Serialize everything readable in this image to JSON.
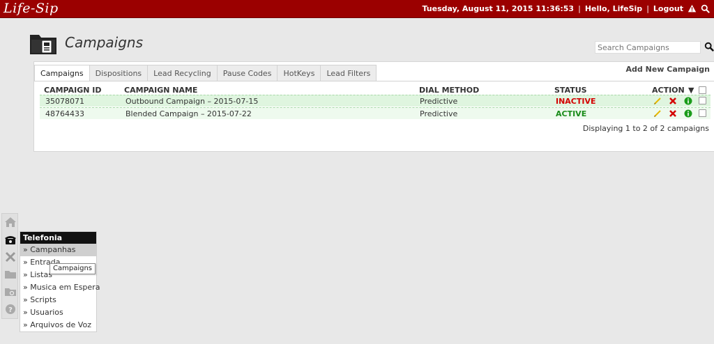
{
  "app": {
    "logo": "Life-Sip"
  },
  "topbar": {
    "datetime": "Tuesday, August 11, 2015 11:36:53",
    "sep1": "|",
    "greeting": "Hello, LifeSip",
    "sep2": "|",
    "logout": "Logout"
  },
  "page": {
    "title": "Campaigns"
  },
  "search": {
    "placeholder": "Search Campaigns"
  },
  "tabs": [
    {
      "label": "Campaigns"
    },
    {
      "label": "Dispositions"
    },
    {
      "label": "Lead Recycling"
    },
    {
      "label": "Pause Codes"
    },
    {
      "label": "HotKeys"
    },
    {
      "label": "Lead Filters"
    }
  ],
  "add_new": "Add New Campaign",
  "table": {
    "headers": {
      "id": "CAMPAIGN ID",
      "name": "CAMPAIGN NAME",
      "dial": "DIAL METHOD",
      "status": "STATUS",
      "action": "ACTION",
      "action_arrow": "▼"
    },
    "rows": [
      {
        "id": "35078071",
        "name": "Outbound Campaign – 2015-07-15",
        "dial": "Predictive",
        "status": "INACTIVE"
      },
      {
        "id": "48764433",
        "name": "Blended Campaign – 2015-07-22",
        "dial": "Predictive",
        "status": "ACTIVE"
      }
    ],
    "count": "Displaying 1 to 2 of 2 campaigns"
  },
  "sidebar": {
    "icons": [
      "home-icon",
      "phone-icon",
      "tools-icon",
      "folder-icon",
      "folder-search-icon",
      "help-icon"
    ]
  },
  "menu": {
    "title": "Telefonia",
    "items": [
      {
        "label": "» Campanhas"
      },
      {
        "label": "» Entrada"
      },
      {
        "label": "» Listas"
      },
      {
        "label": "» Musica em Espera"
      },
      {
        "label": "» Scripts"
      },
      {
        "label": "» Usuarios"
      },
      {
        "label": "» Arquivos de Voz"
      }
    ]
  },
  "tooltip": {
    "text": "Campaigns"
  },
  "colors": {
    "topbar": "#9b0000",
    "inactive": "#d40000",
    "active": "#1a8c1a",
    "row_highlight": "#dff5df"
  }
}
